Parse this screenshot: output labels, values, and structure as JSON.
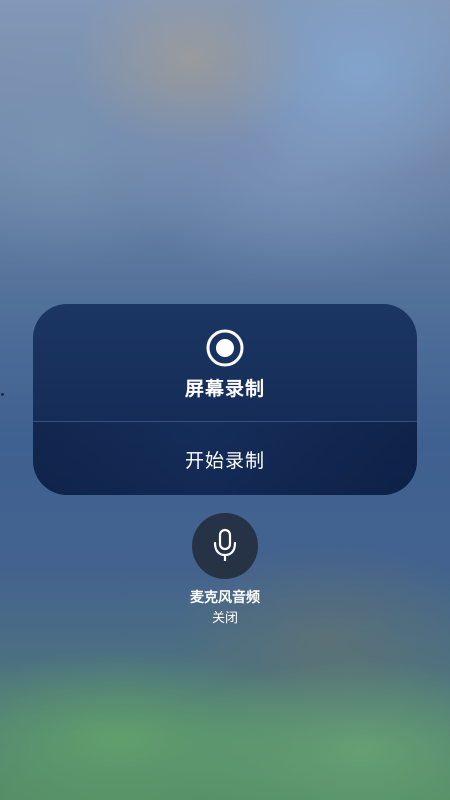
{
  "screen_recording": {
    "title": "屏幕录制",
    "start_label": "开始录制",
    "icon": "record-icon"
  },
  "microphone": {
    "label": "麦克风音频",
    "status": "关闭",
    "icon": "microphone-icon"
  },
  "colors": {
    "card_background": "#14305c",
    "mic_button_background": "#202834",
    "text": "#ffffff"
  }
}
